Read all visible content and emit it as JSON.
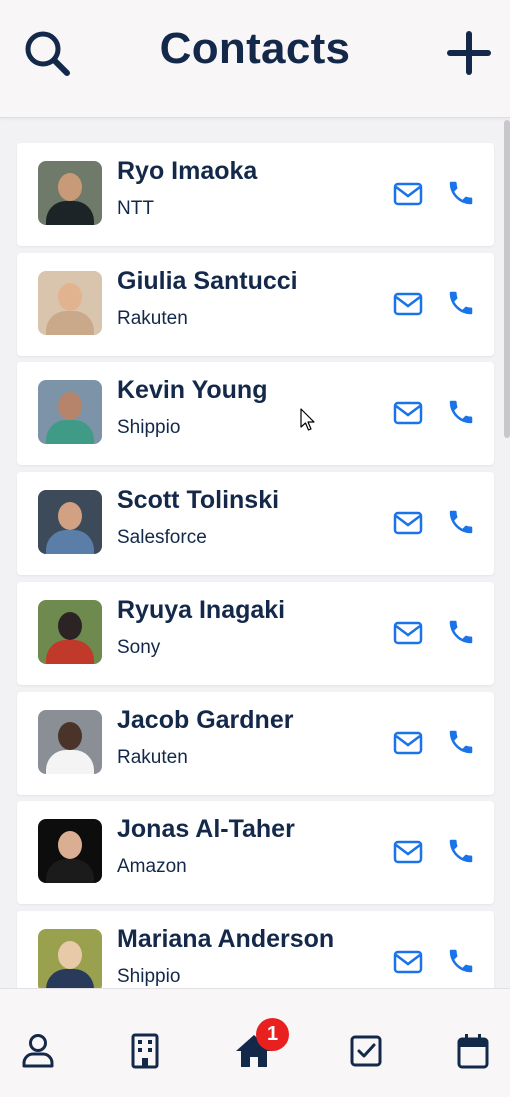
{
  "header": {
    "title": "Contacts",
    "search_icon": "search-icon",
    "add_icon": "plus-icon"
  },
  "contacts": [
    {
      "name": "Ryo Imaoka",
      "company": "NTT"
    },
    {
      "name": "Giulia Santucci",
      "company": "Rakuten"
    },
    {
      "name": "Kevin Young",
      "company": "Shippio"
    },
    {
      "name": "Scott Tolinski",
      "company": "Salesforce"
    },
    {
      "name": "Ryuya Inagaki",
      "company": "Sony"
    },
    {
      "name": "Jacob Gardner",
      "company": "Rakuten"
    },
    {
      "name": "Jonas Al-Taher",
      "company": "Amazon"
    },
    {
      "name": "Mariana Anderson",
      "company": "Shippio"
    }
  ],
  "tabbar": {
    "items": [
      "person-icon",
      "building-icon",
      "home-icon",
      "checkbox-icon",
      "calendar-icon"
    ],
    "badge_count": "1"
  },
  "colors": {
    "accent": "#1a73e8",
    "primary_text": "#14294a",
    "badge": "#e8201f",
    "background": "#f2f1f4"
  }
}
